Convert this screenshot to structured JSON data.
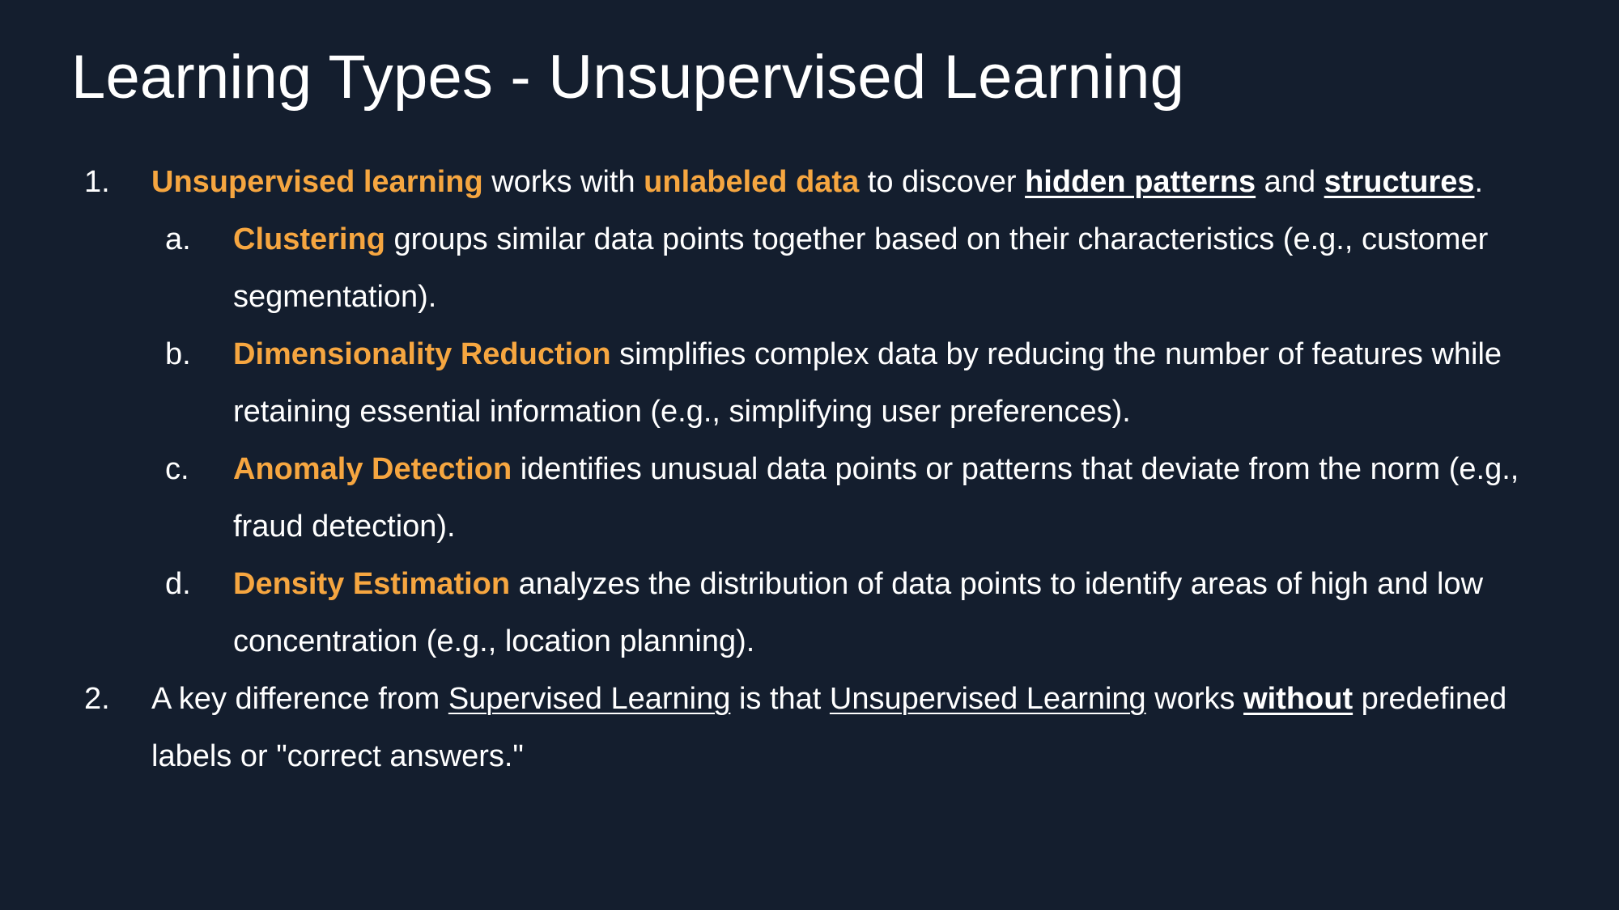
{
  "slide": {
    "title": "Learning Types - Unsupervised Learning",
    "item1": {
      "marker": "1.",
      "term": "Unsupervised learning",
      "t1": " works with ",
      "key": "unlabeled data",
      "t2": " to discover ",
      "link1": "hidden patterns",
      "t3": " and ",
      "link2": "structures",
      "t4": "."
    },
    "item_a": {
      "marker": "a.",
      "term": "Clustering",
      "text": " groups similar data points together based on their characteristics (e.g., customer segmentation)."
    },
    "item_b": {
      "marker": "b.",
      "term": "Dimensionality Reduction",
      "text": " simplifies complex data by reducing the number of features while retaining essential information (e.g., simplifying user preferences)."
    },
    "item_c": {
      "marker": "c.",
      "term": "Anomaly Detection",
      "text": " identifies unusual data points or patterns that deviate from the norm (e.g., fraud detection)."
    },
    "item_d": {
      "marker": "d.",
      "term": "Density Estimation",
      "text": " analyzes the distribution of data points to identify areas of high and low concentration (e.g., location planning)."
    },
    "item2": {
      "marker": "2.",
      "t1": "A key difference from ",
      "u1": "Supervised Learning",
      "t2": " is that ",
      "u2": "Unsupervised Learning",
      "t3": " works ",
      "bu": "without",
      "t4": " predefined labels or \"correct answers.\""
    }
  },
  "colors": {
    "background": "#141e2e",
    "accent": "#f6a640",
    "text": "#ffffff"
  }
}
